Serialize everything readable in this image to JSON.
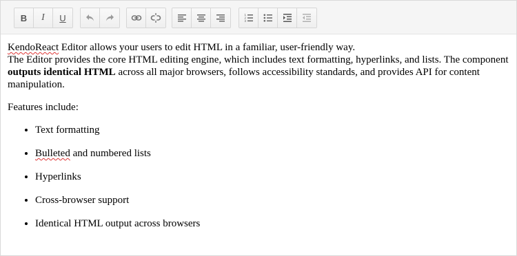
{
  "toolbar": {
    "bold_label": "B",
    "italic_label": "I",
    "underline_label": "U",
    "icons": [
      "undo-icon",
      "redo-icon",
      "link-icon",
      "unlink-icon",
      "align-left-icon",
      "align-center-icon",
      "align-right-icon",
      "ordered-list-icon",
      "unordered-list-icon",
      "indent-icon",
      "outdent-icon"
    ]
  },
  "content": {
    "intro": {
      "product": "KendoReact",
      "line1_rest": " Editor allows your users to edit HTML in a familiar, user-friendly way.",
      "line2_start": "The Editor provides the core HTML editing engine, which includes text formatting, hyperlinks, and lists. The component ",
      "bold": "outputs identical HTML",
      "line2_end": " across all major browsers, follows accessibility standards, and provides API for content manipulation."
    },
    "features_heading": "Features include:",
    "features": [
      "Text formatting",
      "Bulleted and numbered lists",
      "Hyperlinks",
      "Cross-browser support",
      "Identical HTML output across browsers"
    ],
    "feature2_word": "Bulleted",
    "feature2_rest": " and numbered lists"
  }
}
